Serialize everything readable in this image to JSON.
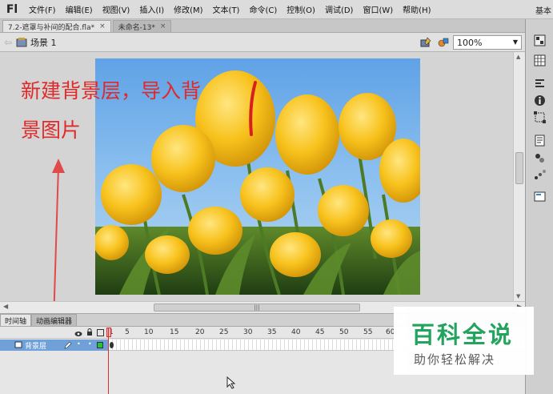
{
  "app": {
    "logo": "Fl",
    "menu": [
      "文件(F)",
      "编辑(E)",
      "视图(V)",
      "插入(I)",
      "修改(M)",
      "文本(T)",
      "命令(C)",
      "控制(O)",
      "调试(D)",
      "窗口(W)",
      "帮助(H)"
    ],
    "workspace": "基本"
  },
  "tabs": [
    {
      "label": "7.2-遮罩与补间的配合.fla*",
      "close": "×"
    },
    {
      "label": "未命名-13*",
      "close": "×"
    }
  ],
  "editbar": {
    "scene_label": "场景 1",
    "zoom": "100%"
  },
  "annotation": {
    "line1": "新建背景层，导入背",
    "line2": "景图片"
  },
  "timeline": {
    "tabs": [
      "时间轴",
      "动画编辑器"
    ],
    "frame_numbers": [
      "1",
      "5",
      "10",
      "15",
      "20",
      "25",
      "30",
      "35",
      "40",
      "45",
      "50",
      "55",
      "60"
    ],
    "layer_name": "背景层"
  },
  "watermark": {
    "title": "百科全说",
    "subtitle": "助你轻松解决"
  },
  "colors": {
    "annotation": "#e02a2a",
    "watermark_green": "#1da25a",
    "layer_selected": "#6fa0d8",
    "playhead": "#d93030"
  }
}
